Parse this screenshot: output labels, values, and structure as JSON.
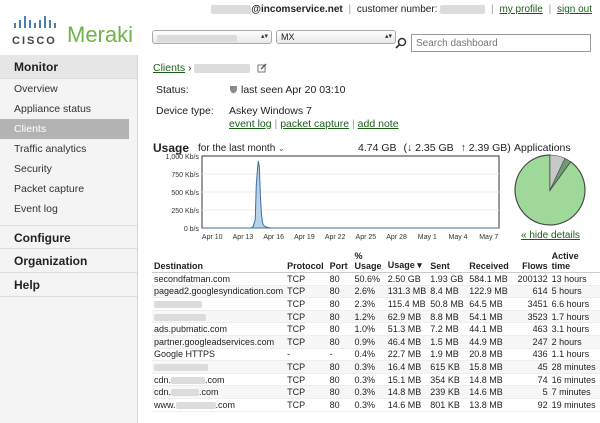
{
  "topbar": {
    "email_domain": "@incomservice.net",
    "customer_label": "customer number:",
    "my_profile": "my profile",
    "sign_out": "sign out"
  },
  "logo": {
    "cisco": "CISCO",
    "meraki": "Meraki"
  },
  "sidebar": {
    "sections": [
      {
        "label": "Monitor",
        "items": [
          "Overview",
          "Appliance status",
          "Clients",
          "Traffic analytics",
          "Security",
          "Packet capture",
          "Event log"
        ]
      },
      {
        "label": "Configure"
      },
      {
        "label": "Organization"
      },
      {
        "label": "Help"
      }
    ],
    "active_item": "Clients"
  },
  "selectors": {
    "network": "MX"
  },
  "search": {
    "placeholder": "Search dashboard"
  },
  "breadcrumb": {
    "root": "Clients",
    "sep": "›"
  },
  "client": {
    "status_label": "Status:",
    "status_value": "last seen Apr 20 03:10",
    "device_label": "Device type:",
    "device_value": "Askey Windows 7",
    "links": [
      "event log",
      "packet capture",
      "add note"
    ]
  },
  "usage": {
    "title": "Usage",
    "range": "for the last month",
    "total": "4.74 GB",
    "down": "(↓ 2.35 GB",
    "up": "↑ 2.39 GB)"
  },
  "chart_data": {
    "type": "area",
    "ylim": [
      0,
      1000
    ],
    "ytick_labels": [
      "1,000 Kb/s",
      "750 Kb/s",
      "500 Kb/s",
      "250 Kb/s",
      "0 b/s"
    ],
    "ytick_values": [
      1000,
      750,
      500,
      250,
      0
    ],
    "xtick_labels": [
      "Apr 10",
      "Apr 13",
      "Apr 16",
      "Apr 19",
      "Apr 22",
      "Apr 25",
      "Apr 28",
      "May 1",
      "May 4",
      "May 7"
    ],
    "x": [
      0,
      4.8,
      5.0,
      5.2,
      5.3,
      5.4,
      5.5,
      5.6,
      5.7,
      5.8,
      5.9,
      6.0,
      6.2,
      6.4,
      6.6,
      6.8,
      29
    ],
    "y": [
      0,
      0,
      20,
      120,
      600,
      780,
      930,
      850,
      450,
      200,
      80,
      40,
      20,
      8,
      4,
      0,
      0
    ]
  },
  "applications": {
    "title": "Applications",
    "hide_details": "« hide details",
    "colors": {
      "main": "#9ed99a",
      "second": "#c7c7c7",
      "third": "#6e9c70"
    },
    "slices": [
      0.9,
      0.07,
      0.03
    ]
  },
  "table": {
    "headers": [
      "Destination",
      "Protocol",
      "Port",
      "% Usage",
      "Usage ▾",
      "Sent",
      "Received",
      "Flows",
      "Active time"
    ],
    "rows": [
      [
        "secondfatman.com",
        "TCP",
        "80",
        "50.6%",
        "2.50 GB",
        "1.93 GB",
        "584.1 MB",
        "200132",
        "13 hours"
      ],
      [
        "pagead2.googlesyndication.com",
        "TCP",
        "80",
        "2.6%",
        "131.3 MB",
        "8.4 MB",
        "122.9 MB",
        "614",
        "5 hours"
      ],
      [
        "",
        "TCP",
        "80",
        "2.3%",
        "115.4 MB",
        "50.8 MB",
        "64.5 MB",
        "3451",
        "6.6 hours"
      ],
      [
        "",
        "TCP",
        "80",
        "1.2%",
        "62.9 MB",
        "8.8 MB",
        "54.1 MB",
        "3523",
        "1.7 hours"
      ],
      [
        "ads.pubmatic.com",
        "TCP",
        "80",
        "1.0%",
        "51.3 MB",
        "7.2 MB",
        "44.1 MB",
        "463",
        "3.1 hours"
      ],
      [
        "partner.googleadservices.com",
        "TCP",
        "80",
        "0.9%",
        "46.4 MB",
        "1.5 MB",
        "44.9 MB",
        "247",
        "2 hours"
      ],
      [
        "Google HTTPS",
        "-",
        "-",
        "0.4%",
        "22.7 MB",
        "1.9 MB",
        "20.8 MB",
        "436",
        "1.1 hours"
      ],
      [
        "",
        "TCP",
        "80",
        "0.3%",
        "16.4 MB",
        "615 KB",
        "15.8 MB",
        "45",
        "28 minutes"
      ],
      [
        "cdn.",
        "TCP",
        "80",
        "0.3%",
        "15.1 MB",
        "354 KB",
        "14.8 MB",
        "74",
        "16 minutes"
      ],
      [
        "cdn.",
        "TCP",
        "80",
        "0.3%",
        "14.8 MB",
        "239 KB",
        "14.6 MB",
        "5",
        "7 minutes"
      ],
      [
        "www.",
        "TCP",
        "80",
        "0.3%",
        "14.6 MB",
        "801 KB",
        "13.8 MB",
        "92",
        "19 minutes"
      ]
    ]
  }
}
